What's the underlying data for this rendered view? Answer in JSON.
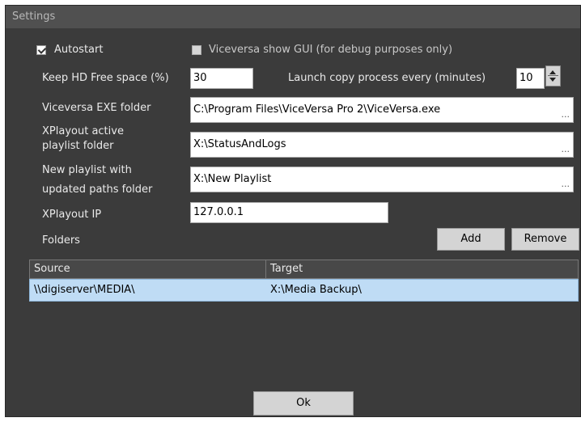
{
  "window": {
    "title": "Settings"
  },
  "options": {
    "autostart": {
      "label": "Autostart",
      "checked": true
    },
    "show_gui": {
      "label": "Viceversa show GUI  (for debug purposes only)",
      "checked": false
    }
  },
  "hd_free": {
    "label": "Keep HD Free space (%)",
    "value": "30"
  },
  "copy_interval": {
    "label": "Launch copy process every (minutes)",
    "value": "10"
  },
  "exe_folder": {
    "label": "Viceversa EXE folder",
    "value": "C:\\Program Files\\ViceVersa Pro 2\\ViceVersa.exe",
    "browse": "..."
  },
  "playlist_folder": {
    "label_line1": "XPlayout active",
    "label_line2": "playlist folder",
    "value": "X:\\StatusAndLogs",
    "browse": "..."
  },
  "new_playlist_folder": {
    "label_line1": "New playlist with",
    "label_line2": "updated paths folder",
    "value": "X:\\New Playlist",
    "browse": "..."
  },
  "xplayout_ip": {
    "label": "XPlayout IP",
    "value": "127.0.0.1"
  },
  "folders": {
    "label": "Folders",
    "add_label": "Add",
    "remove_label": "Remove",
    "columns": [
      "Source",
      "Target"
    ],
    "rows": [
      {
        "source": "\\\\digiserver\\MEDIA\\",
        "target": "X:\\Media Backup\\"
      }
    ]
  },
  "ok_label": "Ok",
  "colors": {
    "background": "#3b3b3b",
    "titlebar": "#505050",
    "selected_row": "#bfdcf5"
  }
}
